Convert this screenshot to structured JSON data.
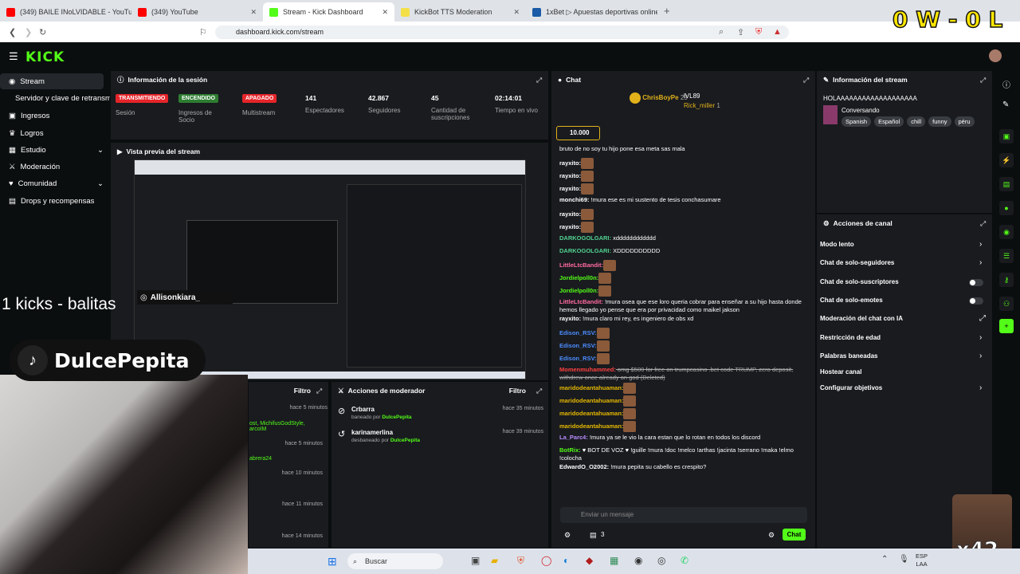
{
  "browser": {
    "tabs": [
      {
        "title": "(349) BAILE INoLVIDABLE - YouTube",
        "color": "#ff0000"
      },
      {
        "title": "(349) YouTube",
        "color": "#ff0000"
      },
      {
        "title": "Stream - Kick Dashboard",
        "color": "#53fc18",
        "active": true
      },
      {
        "title": "KickBot TTS Moderation",
        "color": "#f3e048"
      },
      {
        "title": "1xBet ▷ Apuestas deportivas online",
        "color": "#1a5aa6"
      }
    ],
    "url": "dashboard.kick.com/stream"
  },
  "overlay": {
    "score": "0 W - 0 L",
    "kicks": "1 kicks - balitas",
    "ig": "Allisonkiara_",
    "tiktok": "DulcePepita",
    "x42": "x42"
  },
  "sidebar": {
    "items": [
      "Stream",
      "Servidor y clave de retransmisión",
      "Ingresos",
      "Logros",
      "Estudio",
      "Moderación",
      "Comunidad",
      "Drops y recompensas"
    ]
  },
  "session": {
    "title": "Información de la sesión",
    "stats": [
      {
        "badge": "TRANSMITIENDO",
        "label": "Sesión",
        "color": "#e5252a"
      },
      {
        "badge": "ENCENDIDO",
        "label": "Ingresos de Socio",
        "color": "#2e7d32"
      },
      {
        "badge": "APAGADO",
        "label": "Multistream",
        "color": "#e5252a"
      },
      {
        "value": "141",
        "label": "Espectadores"
      },
      {
        "value": "42.867",
        "label": "Seguidores"
      },
      {
        "value": "45",
        "label": "Cantidad de suscripciones"
      },
      {
        "value": "02:14:01",
        "label": "Tiempo en vivo"
      }
    ]
  },
  "preview": {
    "title": "Vista previa del stream"
  },
  "chat": {
    "title": "Chat",
    "top": [
      {
        "name": "ChrisBoyPe",
        "n": "25"
      },
      {
        "name": "lVL89",
        "n": ""
      },
      {
        "name": "Rick_miller",
        "n": "1"
      }
    ],
    "gift": "10.000",
    "messages": [
      {
        "user": "",
        "text": "bruto de no soy tu hijo pone esa meta sas mala",
        "color": "#fff"
      },
      {
        "user": "rayxito:",
        "text": "",
        "color": "#fff",
        "emote": true
      },
      {
        "user": "rayxito:",
        "text": "",
        "color": "#fff",
        "emote": true
      },
      {
        "user": "rayxito:",
        "text": "",
        "color": "#fff",
        "emote": true
      },
      {
        "user": "monchi69:",
        "text": " !mura ese es mi sustento de tesis conchasumare",
        "color": "#fff"
      },
      {
        "user": "rayxito:",
        "text": "",
        "color": "#fff",
        "emote": true
      },
      {
        "user": "rayxito:",
        "text": "",
        "color": "#fff",
        "emote": true
      },
      {
        "user": "DARKOGOLGARI:",
        "text": " xdddddddddddd",
        "color": "#52d391"
      },
      {
        "user": "DARKOGOLGARI:",
        "text": " XDDDDDDDDDD",
        "color": "#52d391"
      },
      {
        "user": "LittleLtcBandit:",
        "text": "",
        "color": "#ff6a9f",
        "emote": true
      },
      {
        "user": "Jordielpoll0n:",
        "text": "",
        "color": "#53fc18",
        "emote": true
      },
      {
        "user": "Jordielpoll0n:",
        "text": "",
        "color": "#53fc18",
        "emote": true
      },
      {
        "user": "LittleLtcBandit:",
        "text": " !mura osea que ese loro queria cobrar para enseñar a su hijo hasta donde hemos llegado yo pense que era por privacidad como maikel jakson",
        "color": "#ff6a9f"
      },
      {
        "user": "rayxito:",
        "text": " !mura claro mi rey, es ingeniero de obs xd",
        "color": "#fff"
      },
      {
        "user": "Edison_RSV:",
        "text": "",
        "color": "#4c8dff",
        "emote": true
      },
      {
        "user": "Edison_RSV:",
        "text": "",
        "color": "#4c8dff",
        "emote": true
      },
      {
        "user": "Edison_RSV:",
        "text": "",
        "color": "#4c8dff",
        "emote": true
      },
      {
        "user": "Momenmuhammed:",
        "text": " omg $500 for free on trumpcasino .bet code TRUMP, zero deposit, withdrew once already on god (Deleted)",
        "color": "#ff4040"
      },
      {
        "user": "maridodeantahuaman:",
        "text": "",
        "color": "#e6b800",
        "emote": true
      },
      {
        "user": "maridodeantahuaman:",
        "text": "",
        "color": "#e6b800",
        "emote": true
      },
      {
        "user": "maridodeantahuaman:",
        "text": "",
        "color": "#e6b800",
        "emote": true
      },
      {
        "user": "maridodeantahuaman:",
        "text": "",
        "color": "#e6b800",
        "emote": true
      },
      {
        "user": "La_Parc4:",
        "text": " !mura ya se le vio la cara estan que lo rotan en todos los discord",
        "color": "#b98cff"
      },
      {
        "user": "BotRix:",
        "text": " ♥ BOT DE VOZ ♥ !guille !mura !doc !melco !arthas !jacinta !serrano !maka !elmo !colocha",
        "color": "#53fc18"
      },
      {
        "user": "EdwardO_O2002:",
        "text": " !mura pepita su cabello es crespito?",
        "color": "#fff"
      }
    ],
    "input_placeholder": "Enviar un mensaje",
    "count": "3",
    "send": "Chat"
  },
  "stream_info": {
    "title": "Información del stream",
    "name": "HOLAAAAAAAAAAAAAAAAAAA",
    "category": "Conversando",
    "tags": [
      "Spanish",
      "Español",
      "chill",
      "funny",
      "péru"
    ]
  },
  "channel_actions": {
    "title": "Acciones de canal",
    "items": [
      "Modo lento",
      "Chat de solo-seguidores",
      "Chat de solo-suscriptores",
      "Chat de solo-emotes",
      "Moderación del chat con IA",
      "Restricción de edad",
      "Palabras baneadas",
      "Hostear canal",
      "Configurar objetivos"
    ]
  },
  "mod_actions": {
    "title": "Acciones de moderador",
    "filter": "Filtro",
    "items": [
      {
        "user": "Crbarra",
        "action": "baneado por",
        "by": "DulcePepita",
        "time": "hace 35 minutos"
      },
      {
        "user": "karinamerlina",
        "action": "desbaneado por",
        "by": "DulcePepita",
        "time": "hace 39 minutos"
      }
    ]
  },
  "left_panel": {
    "filter": "Filtro",
    "times": [
      "hace 5 minutos",
      "hace 5 minutos",
      "hace 10 minutos",
      "hace 11 minutos",
      "hace 14 minutos"
    ],
    "names": [
      "ost, MichifusGodStyle, arcoIM",
      "abrera24"
    ]
  },
  "taskbar": {
    "search": "Buscar",
    "lang1": "ESP",
    "lang2": "LAA"
  }
}
